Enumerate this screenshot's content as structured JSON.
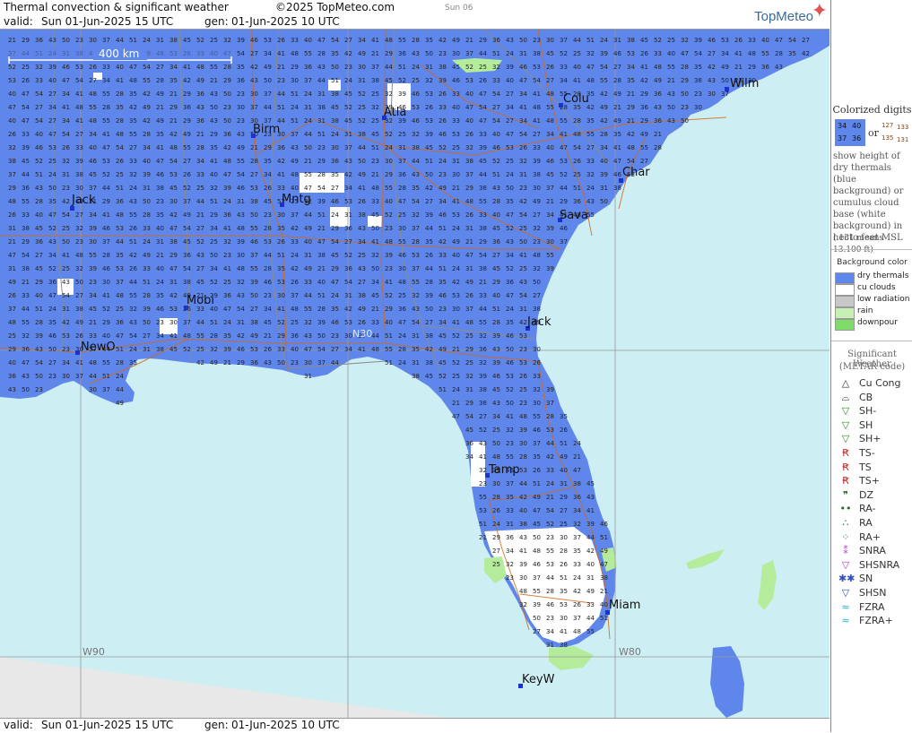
{
  "header": {
    "title": "Thermal convection & significant weather",
    "copyright": "©2025 TopMeteo.com",
    "day_tab": "Sun 06",
    "valid_label": "valid:",
    "valid_value": "Sun  01-Jun-2025  15 UTC",
    "gen_label": "gen:",
    "gen_value": "01-Jun-2025 10 UTC",
    "logo": "TopMeteo"
  },
  "footer": {
    "valid_label": "valid:",
    "valid_value": "Sun  01-Jun-2025  15 UTC",
    "gen_label": "gen:",
    "gen_value": "01-Jun-2025 10 UTC"
  },
  "map": {
    "scale_label": "400 km",
    "coord_labels": [
      "W90",
      "W80",
      "N30"
    ],
    "cities": [
      "Wilm",
      "Colu",
      "Atla",
      "Birm",
      "Char",
      "Jack",
      "Mntg",
      "Sava",
      "Mobi",
      "Jack",
      "NewO",
      "Tamp",
      "Miam",
      "KeyW"
    ],
    "land_color": "#5f86ea",
    "cloud_color": "#ffffff",
    "rain_color": "#b4ec9c",
    "sea_color": "#cdeef3",
    "road_color": "#d2691e",
    "border_color": "#8c8c8c",
    "cell_values": [
      "21",
      "23",
      "24",
      "25",
      "26",
      "27",
      "28",
      "29",
      "30",
      "31",
      "32",
      "33",
      "34",
      "35",
      "36",
      "37",
      "38",
      "39",
      "40",
      "41",
      "42",
      "43",
      "44",
      "45",
      "46",
      "47",
      "48",
      "49",
      "50",
      "51",
      "52",
      "53",
      "54",
      "55"
    ]
  },
  "legend": {
    "colorized_title": "Colorized digits",
    "sample_digits": [
      "34",
      "40",
      "37",
      "36"
    ],
    "sample_or": "or",
    "sample_cloud_digits": [
      "127",
      "133",
      "135",
      "131"
    ],
    "description": "show height of dry thermals (blue background) or cumulus cloud base (white background) in hecto feet MSL",
    "example": "( 131 means 13.100 ft)",
    "bg_title": "Background color",
    "bg_items": [
      {
        "label": "dry thermals",
        "color": "#5f86ea"
      },
      {
        "label": "cu clouds",
        "color": "#ffffff"
      },
      {
        "label": "low radiation",
        "color": "#c8c8c8"
      },
      {
        "label": "rain",
        "color": "#c9f0b4"
      },
      {
        "label": "downpour",
        "color": "#7fdc6a"
      }
    ],
    "sig_title": "Significant Weather",
    "sig_subtitle": "(METAR code)",
    "wx_items": [
      {
        "label": "Cu Cong",
        "icon": "cu-cong-icon",
        "symbol": "△",
        "color": "#333333"
      },
      {
        "label": "CB",
        "icon": "cb-icon",
        "symbol": "⌓",
        "color": "#333333"
      },
      {
        "label": "SH-",
        "icon": "shower-light-icon",
        "symbol": "▽",
        "color": "#2e8b2e"
      },
      {
        "label": "SH",
        "icon": "shower-icon",
        "symbol": "▽",
        "color": "#2e8b2e"
      },
      {
        "label": "SH+",
        "icon": "shower-heavy-icon",
        "symbol": "▽",
        "color": "#2e8b2e"
      },
      {
        "label": "TS-",
        "icon": "thunderstorm-light-icon",
        "symbol": "Ꞧ",
        "color": "#c03030"
      },
      {
        "label": "TS",
        "icon": "thunderstorm-icon",
        "symbol": "Ꞧ",
        "color": "#c03030"
      },
      {
        "label": "TS+",
        "icon": "thunderstorm-heavy-icon",
        "symbol": "Ꞧ",
        "color": "#c03030"
      },
      {
        "label": "DZ",
        "icon": "drizzle-icon",
        "symbol": "❞",
        "color": "#1e6b1e"
      },
      {
        "label": "RA-",
        "icon": "rain-light-icon",
        "symbol": "••",
        "color": "#1e6b1e"
      },
      {
        "label": "RA",
        "icon": "rain-icon",
        "symbol": "∴",
        "color": "#1e6b1e"
      },
      {
        "label": "RA+",
        "icon": "rain-heavy-icon",
        "symbol": "⁘",
        "color": "#1e6b1e"
      },
      {
        "label": "SNRA",
        "icon": "snow-rain-icon",
        "symbol": "⁑",
        "color": "#b040c0"
      },
      {
        "label": "SHSNRA",
        "icon": "snow-rain-shower-icon",
        "symbol": "▽",
        "color": "#b040c0"
      },
      {
        "label": "SN",
        "icon": "snow-icon",
        "symbol": "✱✱",
        "color": "#3050c0"
      },
      {
        "label": "SHSN",
        "icon": "snow-shower-icon",
        "symbol": "▽",
        "color": "#3050c0"
      },
      {
        "label": "FZRA",
        "icon": "freezing-rain-icon",
        "symbol": "≈",
        "color": "#20b0c0"
      },
      {
        "label": "FZRA+",
        "icon": "freezing-rain-heavy-icon",
        "symbol": "≈",
        "color": "#20b0c0"
      }
    ]
  }
}
